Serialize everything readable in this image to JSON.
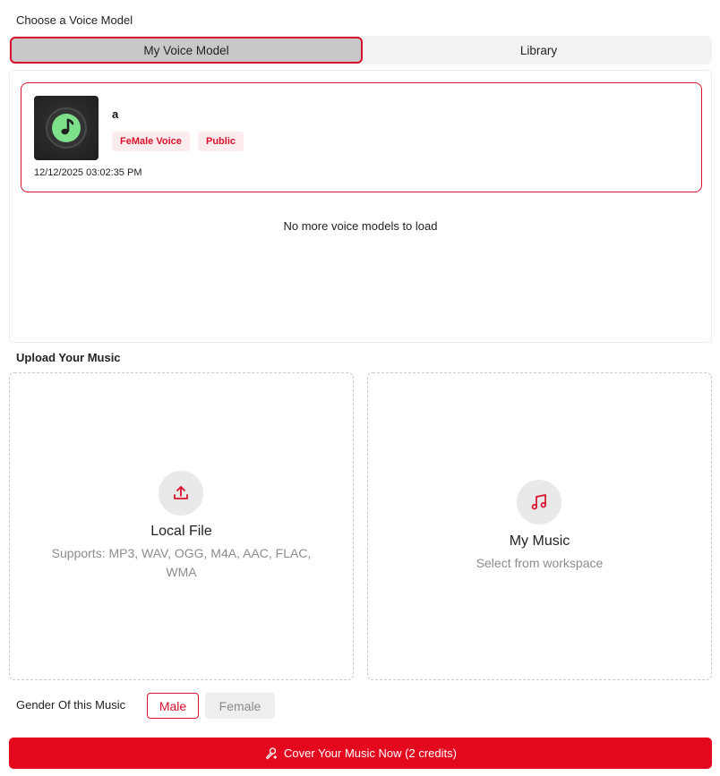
{
  "voice_model": {
    "section_label": "Choose a Voice Model",
    "tabs": [
      {
        "label": "My Voice Model",
        "active": true
      },
      {
        "label": "Library",
        "active": false
      }
    ],
    "models": [
      {
        "name": "a",
        "thumbnail_icon": "music-note-icon",
        "badges": [
          "FeMale Voice",
          "Public"
        ],
        "date": "12/12/2025 03:02:35 PM",
        "selected": true
      }
    ],
    "end_message": "No more voice models to load"
  },
  "upload": {
    "section_label": "Upload Your Music",
    "local_file": {
      "icon": "upload-icon",
      "title": "Local File",
      "subtitle": "Supports: MP3, WAV, OGG, M4A, AAC, FLAC, WMA"
    },
    "my_music": {
      "icon": "music-notes-icon",
      "title": "My Music",
      "subtitle": "Select from workspace"
    }
  },
  "gender": {
    "label": "Gender Of this Music",
    "options": [
      {
        "label": "Male",
        "selected": true
      },
      {
        "label": "Female",
        "selected": false
      }
    ]
  },
  "submit": {
    "icon": "microphone-icon",
    "label": "Cover Your Music Now (2 credits)"
  },
  "colors": {
    "accent": "#d9112a",
    "button_red": "#e3081e",
    "badge_bg": "#fdecee",
    "muted_text": "#8c8c8c"
  }
}
